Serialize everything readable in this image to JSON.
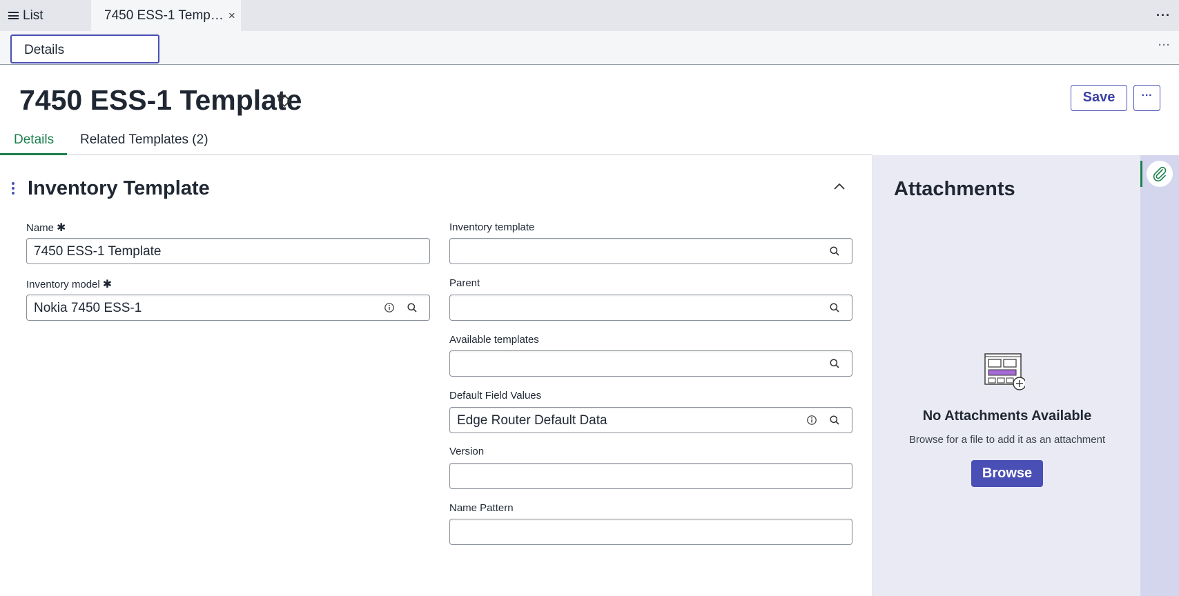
{
  "tabstrip": {
    "list_label": "List",
    "active_tab_label": "7450 ESS-1 Temp…",
    "close_glyph": "×",
    "more_glyph": "···"
  },
  "subbar": {
    "tab_label": "Details",
    "more_glyph": "···"
  },
  "header": {
    "title": "7450 ESS-1 Template",
    "save_label": "Save",
    "more_glyph": "···"
  },
  "form_tabs": [
    {
      "label": "Details",
      "active": true
    },
    {
      "label": "Related Templates (2)",
      "active": false
    }
  ],
  "section": {
    "title": "Inventory Template"
  },
  "fields": {
    "name": {
      "label": "Name",
      "required_glyph": "✱",
      "value": "7450 ESS-1 Template"
    },
    "inventory_model": {
      "label": "Inventory model",
      "required_glyph": "✱",
      "value": "Nokia 7450 ESS-1"
    },
    "inventory_template": {
      "label": "Inventory template",
      "value": ""
    },
    "parent": {
      "label": "Parent",
      "value": ""
    },
    "available_templates": {
      "label": "Available templates",
      "value": ""
    },
    "default_field_values": {
      "label": "Default Field Values",
      "value": "Edge Router Default Data"
    },
    "version": {
      "label": "Version",
      "value": ""
    },
    "name_pattern": {
      "label": "Name Pattern",
      "value": ""
    }
  },
  "attachments": {
    "title": "Attachments",
    "empty_title": "No Attachments Available",
    "empty_hint": "Browse for a file to add it as an attachment",
    "browse_label": "Browse"
  },
  "colors": {
    "accent": "#4a4fb5",
    "active_tab": "#1a7f4b",
    "panel_bg": "#e9eaf3"
  }
}
